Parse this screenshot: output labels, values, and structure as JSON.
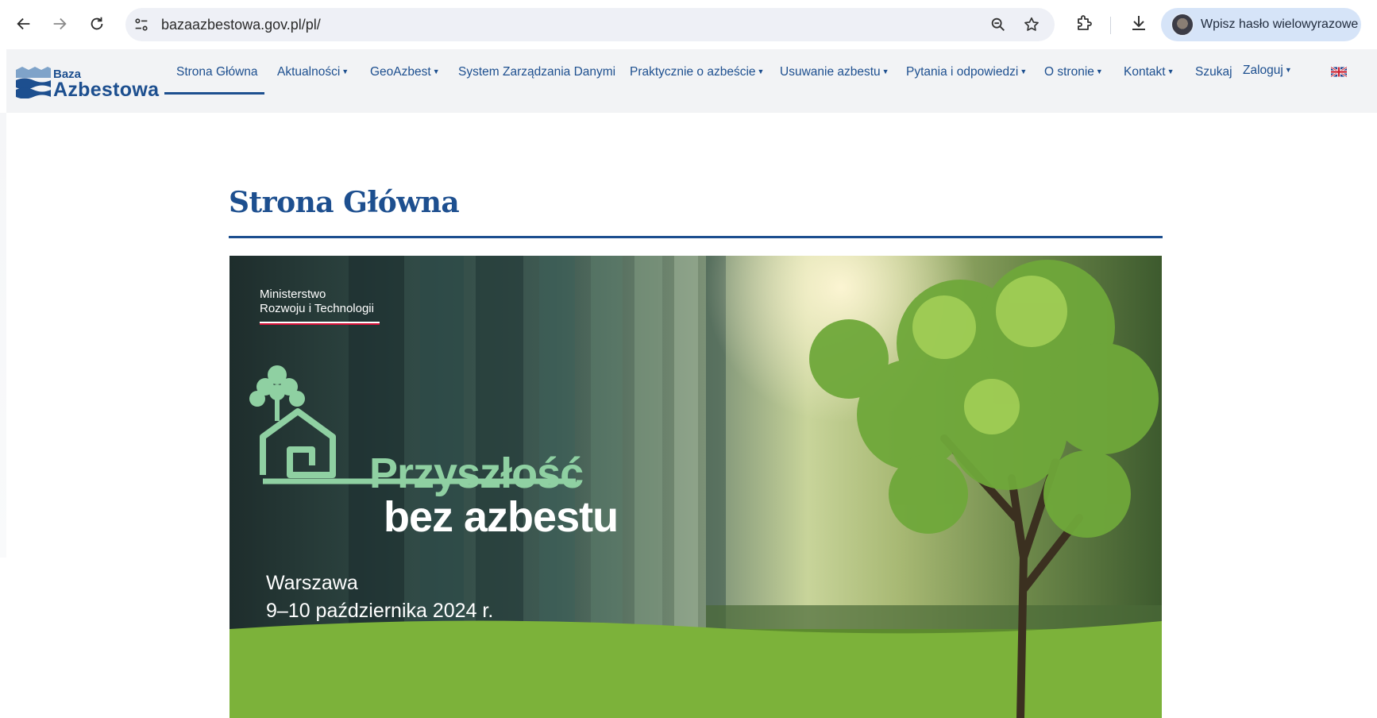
{
  "browser": {
    "url": "bazaazbestowa.gov.pl/pl/",
    "profile_label": "Wpisz hasło wielowyrazowe",
    "icons": [
      "back-icon",
      "forward-icon",
      "reload-icon",
      "site-settings-icon",
      "zoom-icon",
      "bookmark-star-icon",
      "extensions-icon",
      "download-icon"
    ]
  },
  "site": {
    "logo_small": "Baza",
    "logo_big": "Azbestowa",
    "menu": [
      {
        "label": "Strona Główna",
        "dropdown": false,
        "active": true
      },
      {
        "label": "Aktualności",
        "dropdown": true
      },
      {
        "label": "GeoAzbest",
        "dropdown": true
      },
      {
        "label": "System Zarządzania Danymi",
        "dropdown": false
      },
      {
        "label": "Praktycznie o azbeście",
        "dropdown": true
      },
      {
        "label": "Usuwanie azbestu",
        "dropdown": true
      },
      {
        "label": "Pytania i odpowiedzi",
        "dropdown": true
      },
      {
        "label": "O stronie",
        "dropdown": true
      },
      {
        "label": "Kontakt",
        "dropdown": true
      },
      {
        "label": "Szukaj",
        "dropdown": false
      },
      {
        "label": "Zaloguj",
        "dropdown": true
      }
    ],
    "language_flag": "uk-flag-icon",
    "accent_color": "#1d4f8f"
  },
  "page": {
    "title": "Strona Główna"
  },
  "banner": {
    "ministry_line1": "Ministerstwo",
    "ministry_line2": "Rozwoju i Technologii",
    "headline_line1": "Przyszłość",
    "headline_line2": "bez azbestu",
    "city": "Warszawa",
    "date": "9–10 października 2024 r."
  }
}
